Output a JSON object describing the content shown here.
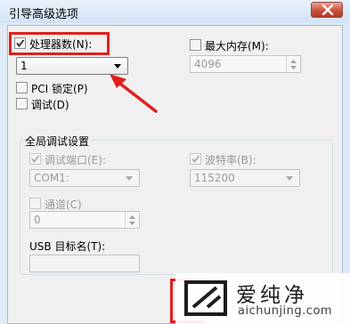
{
  "window": {
    "title": "引导高级选项"
  },
  "processors": {
    "label": "处理器数(N):",
    "checked": true,
    "value": "1"
  },
  "max_memory": {
    "label": "最大内存(M):",
    "checked": false,
    "value": "4096"
  },
  "pci_lock": {
    "label": "PCI 锁定(P)",
    "checked": false
  },
  "debug": {
    "label": "调试(D)",
    "checked": false
  },
  "global_debug": {
    "group_title": "全局调试设置",
    "debug_port": {
      "label": "调试端口(E):",
      "checked": true,
      "value": "COM1:"
    },
    "baud_rate": {
      "label": "波特率(B):",
      "checked": true,
      "value": "115200"
    },
    "channel": {
      "label": "通道(C)",
      "checked": false,
      "value": "0"
    },
    "usb_target": {
      "label": "USB 目标名(T):",
      "value": ""
    }
  },
  "watermark": {
    "name": "爱纯净",
    "url": "aichunjing.com"
  },
  "colors": {
    "highlight": "#e01f1f",
    "titlebar": "#dfeaf6",
    "dialog_bg": "#f0f0f0"
  }
}
